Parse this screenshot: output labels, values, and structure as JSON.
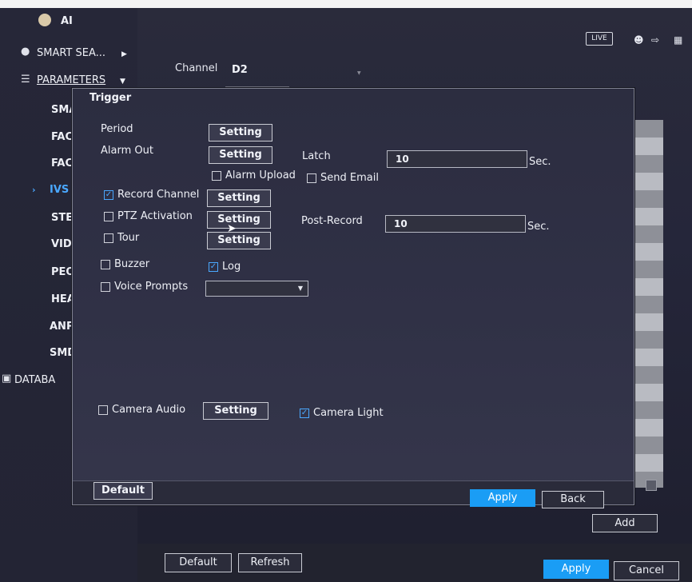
{
  "header": {
    "app_name": "AI",
    "live_label": "LIVE",
    "user_icon": "user-icon",
    "logout_icon": "logout-icon",
    "grid_icon": "grid-icon"
  },
  "sidebar": {
    "smart_search": "SMART SEA...",
    "parameters": "PARAMETERS",
    "items": [
      {
        "label": "SMAR"
      },
      {
        "label": "FACE"
      },
      {
        "label": "FACE"
      },
      {
        "label": "IVS",
        "active": true
      },
      {
        "label": "STER"
      },
      {
        "label": "VIDEC"
      },
      {
        "label": "PEOP"
      },
      {
        "label": "HEAT"
      },
      {
        "label": "ANPR"
      },
      {
        "label": "SMD"
      }
    ],
    "database": "DATABA"
  },
  "background": {
    "channel_label": "Channel",
    "channel_value": "D2",
    "add_label": "Add",
    "default_label": "Default",
    "refresh_label": "Refresh",
    "apply_label": "Apply",
    "cancel_label": "Cancel"
  },
  "dialog": {
    "title": "Trigger",
    "period_label": "Period",
    "alarm_out_label": "Alarm Out",
    "latch_label": "Latch",
    "latch_value": "10",
    "latch_unit": "Sec.",
    "alarm_upload_label": "Alarm Upload",
    "alarm_upload_checked": false,
    "send_email_label": "Send Email",
    "send_email_checked": false,
    "record_channel_label": "Record Channel",
    "record_channel_checked": true,
    "ptz_activation_label": "PTZ Activation",
    "ptz_activation_checked": false,
    "post_record_label": "Post-Record",
    "post_record_value": "10",
    "post_record_unit": "Sec.",
    "tour_label": "Tour",
    "tour_checked": false,
    "buzzer_label": "Buzzer",
    "buzzer_checked": false,
    "log_label": "Log",
    "log_checked": true,
    "voice_prompts_label": "Voice Prompts",
    "voice_prompts_checked": false,
    "voice_prompts_value": "",
    "camera_audio_label": "Camera Audio",
    "camera_audio_checked": false,
    "camera_light_label": "Camera Light",
    "camera_light_checked": true,
    "setting_label": "Setting",
    "default_label": "Default",
    "apply_label": "Apply",
    "back_label": "Back"
  },
  "colors": {
    "accent": "#1a9df5",
    "active_nav": "#4aa8ff",
    "dialog_bg": "#2f3045"
  }
}
